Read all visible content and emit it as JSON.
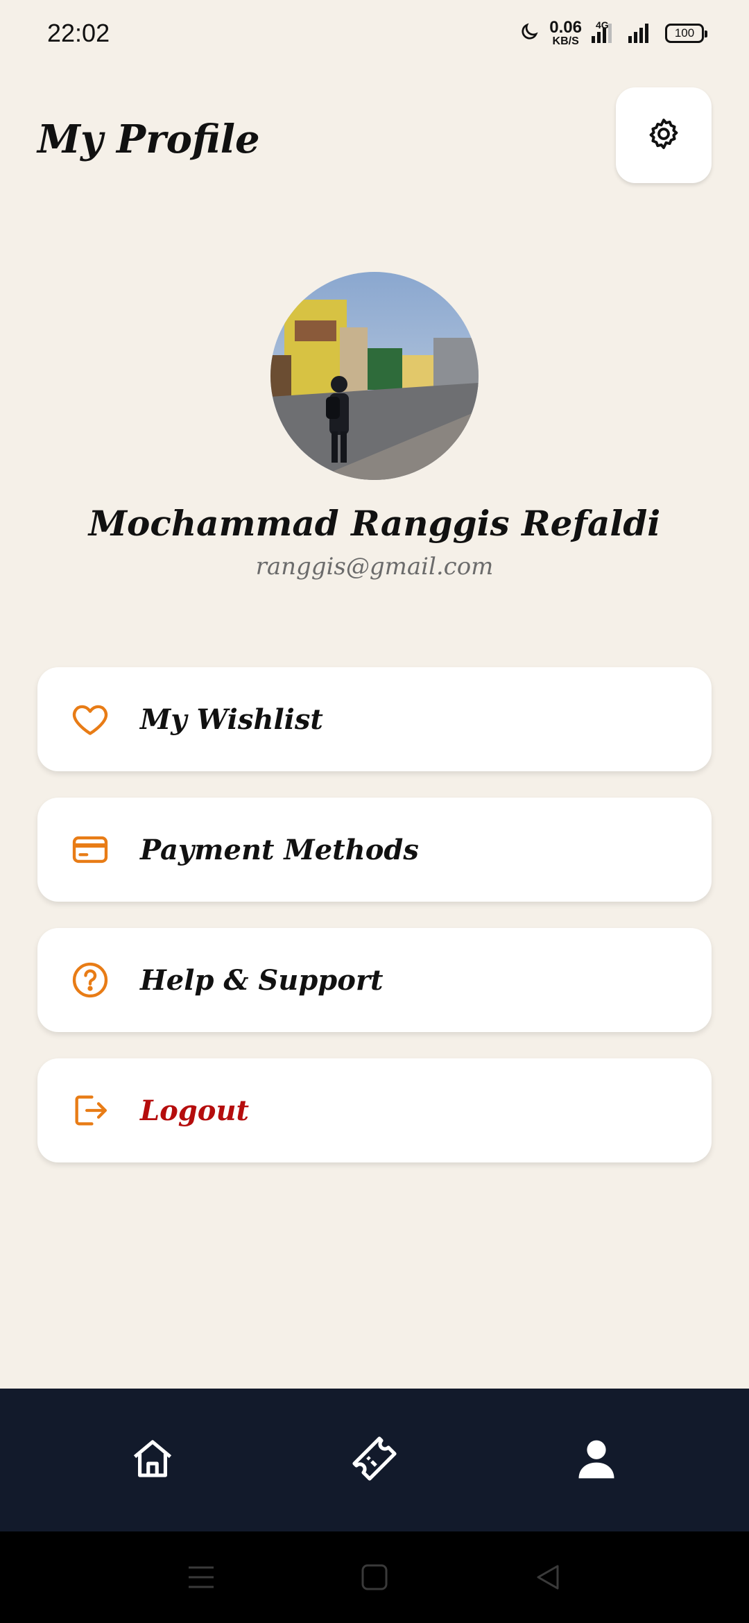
{
  "status_bar": {
    "time": "22:02",
    "speed_value": "0.06",
    "speed_unit": "KB/S",
    "network": "4G",
    "battery": "100",
    "icons": [
      "moon-icon",
      "signal-icon",
      "signal-icon",
      "battery-icon"
    ]
  },
  "header": {
    "title": "My Profile",
    "settings_icon": "gear-icon"
  },
  "profile": {
    "name": "Mochammad Ranggis Refaldi",
    "email": "ranggis@gmail.com"
  },
  "menu": [
    {
      "label": "My Wishlist",
      "icon": "heart-icon"
    },
    {
      "label": "Payment Methods",
      "icon": "credit-card-icon"
    },
    {
      "label": "Help & Support",
      "icon": "help-circle-icon"
    },
    {
      "label": "Logout",
      "icon": "logout-icon"
    }
  ],
  "bottom_nav": {
    "items": [
      {
        "icon": "home-icon"
      },
      {
        "icon": "ticket-icon"
      },
      {
        "icon": "user-icon",
        "active": true
      }
    ]
  },
  "colors": {
    "background": "#f5f0e8",
    "accent": "#e87c16",
    "danger": "#b50d0d",
    "nav_background": "#121a2b"
  }
}
